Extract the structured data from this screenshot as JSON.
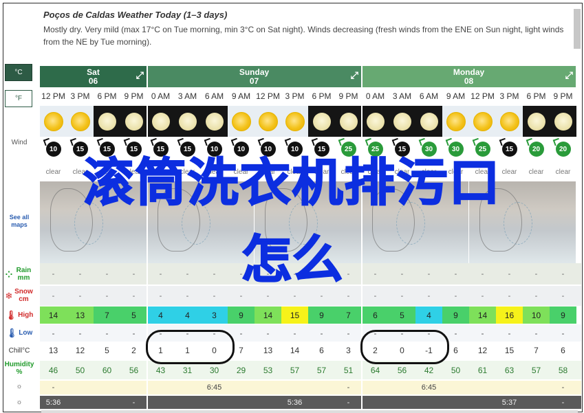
{
  "header": {
    "title": "Poços de Caldas Weather Today (1–3 days)",
    "description": "Mostly dry. Very mild (max 17°C on Tue morning, min 3°C on Sat night). Winds decreasing (fresh winds from the ENE on Sun night, light winds from the NE by Tue morning)."
  },
  "units": {
    "celsius": "°C",
    "fahrenheit": "°F"
  },
  "row_labels": {
    "wind": "Wind",
    "see_all_maps": "See all maps",
    "rain": "Rain mm",
    "snow": "Snow cm",
    "high": "High",
    "low": "Low",
    "chill": "Chill°C",
    "humidity": "Humidity %"
  },
  "days": [
    {
      "name": "Sat",
      "date": "06",
      "color": "#2e6b4a"
    },
    {
      "name": "Sunday",
      "date": "07",
      "color": "#4a8a62"
    },
    {
      "name": "Monday",
      "date": "08",
      "color": "#67a972"
    }
  ],
  "times": [
    "12 PM",
    "3 PM",
    "6 PM",
    "9 PM",
    "0 AM",
    "3 AM",
    "6 AM",
    "9 AM",
    "12 PM",
    "3 PM",
    "6 PM",
    "9 PM",
    "0 AM",
    "3 AM",
    "6 AM",
    "9 AM",
    "12 PM",
    "3 PM",
    "6 PM",
    "9 PM"
  ],
  "sky": [
    "sun",
    "sun",
    "moon",
    "moon",
    "moon",
    "moon",
    "moon",
    "sun",
    "sun",
    "sun",
    "moon",
    "moon",
    "moon",
    "moon",
    "moon",
    "sun",
    "sun",
    "sun",
    "moon",
    "moon"
  ],
  "wind": [
    {
      "v": "10",
      "c": "black"
    },
    {
      "v": "15",
      "c": "black"
    },
    {
      "v": "15",
      "c": "black"
    },
    {
      "v": "15",
      "c": "black"
    },
    {
      "v": "15",
      "c": "black"
    },
    {
      "v": "15",
      "c": "black"
    },
    {
      "v": "10",
      "c": "black"
    },
    {
      "v": "10",
      "c": "black"
    },
    {
      "v": "10",
      "c": "black"
    },
    {
      "v": "10",
      "c": "black"
    },
    {
      "v": "15",
      "c": "black"
    },
    {
      "v": "25",
      "c": "green"
    },
    {
      "v": "25",
      "c": "green"
    },
    {
      "v": "15",
      "c": "black"
    },
    {
      "v": "30",
      "c": "green"
    },
    {
      "v": "30",
      "c": "green"
    },
    {
      "v": "25",
      "c": "green"
    },
    {
      "v": "15",
      "c": "black"
    },
    {
      "v": "20",
      "c": "green"
    },
    {
      "v": "20",
      "c": "green"
    }
  ],
  "clear": [
    "clear",
    "clear",
    "clear",
    "clear",
    "clear",
    "clear",
    "clear",
    "clear",
    "clear",
    "clear",
    "clear",
    "clear",
    "clear",
    "clear",
    "clear",
    "clear",
    "clear",
    "clear",
    "clear",
    "clear"
  ],
  "rain": [
    "-",
    "-",
    "-",
    "-",
    "-",
    "-",
    "-",
    "-",
    "-",
    "-",
    "-",
    "-",
    "-",
    "-",
    "-",
    "-",
    "-",
    "-",
    "-",
    "-"
  ],
  "snow": [
    "-",
    "-",
    "-",
    "-",
    "-",
    "-",
    "-",
    "-",
    "-",
    "-",
    "-",
    "-",
    "-",
    "-",
    "-",
    "-",
    "-",
    "-",
    "-",
    "-"
  ],
  "high": [
    "14",
    "13",
    "7",
    "5",
    "4",
    "4",
    "3",
    "9",
    "14",
    "15",
    "9",
    "7",
    "6",
    "5",
    "4",
    "9",
    "14",
    "16",
    "10",
    "9"
  ],
  "high_colors": [
    "#7ee05a",
    "#7ee05a",
    "#49d06a",
    "#49d06a",
    "#2fd0e6",
    "#2fd0e6",
    "#2fd0e6",
    "#49d06a",
    "#7ee05a",
    "#f6f21a",
    "#49d06a",
    "#49d06a",
    "#49d06a",
    "#49d06a",
    "#2fd0e6",
    "#49d06a",
    "#7ee05a",
    "#f6f21a",
    "#7ee05a",
    "#49d06a"
  ],
  "low": [
    "-",
    "-",
    "-",
    "-",
    "-",
    "-",
    "-",
    "-",
    "-",
    "-",
    "-",
    "-",
    "-",
    "-",
    "-",
    "-",
    "-",
    "-",
    "-",
    "-"
  ],
  "chill": [
    "13",
    "12",
    "5",
    "2",
    "1",
    "1",
    "0",
    "7",
    "13",
    "14",
    "6",
    "3",
    "2",
    "0",
    "-1",
    "6",
    "12",
    "15",
    "7",
    "6"
  ],
  "humidity": [
    "46",
    "50",
    "60",
    "56",
    "43",
    "31",
    "30",
    "29",
    "53",
    "57",
    "57",
    "51",
    "64",
    "56",
    "42",
    "50",
    "61",
    "63",
    "57",
    "58"
  ],
  "sunrise": [
    "-",
    "",
    "",
    "",
    "",
    "",
    "6:45",
    "",
    "",
    "",
    "",
    "-",
    "",
    "",
    "6:45",
    "",
    "",
    "",
    "",
    "-"
  ],
  "sunset": [
    "5:36",
    "",
    "",
    "-",
    "",
    "",
    "",
    "",
    "",
    "5:36",
    "",
    "-",
    "",
    "",
    "",
    "",
    "",
    "5:37",
    "",
    "-"
  ],
  "overlay": {
    "line1": "滚筒洗衣机排污口",
    "line2": "怎么"
  }
}
